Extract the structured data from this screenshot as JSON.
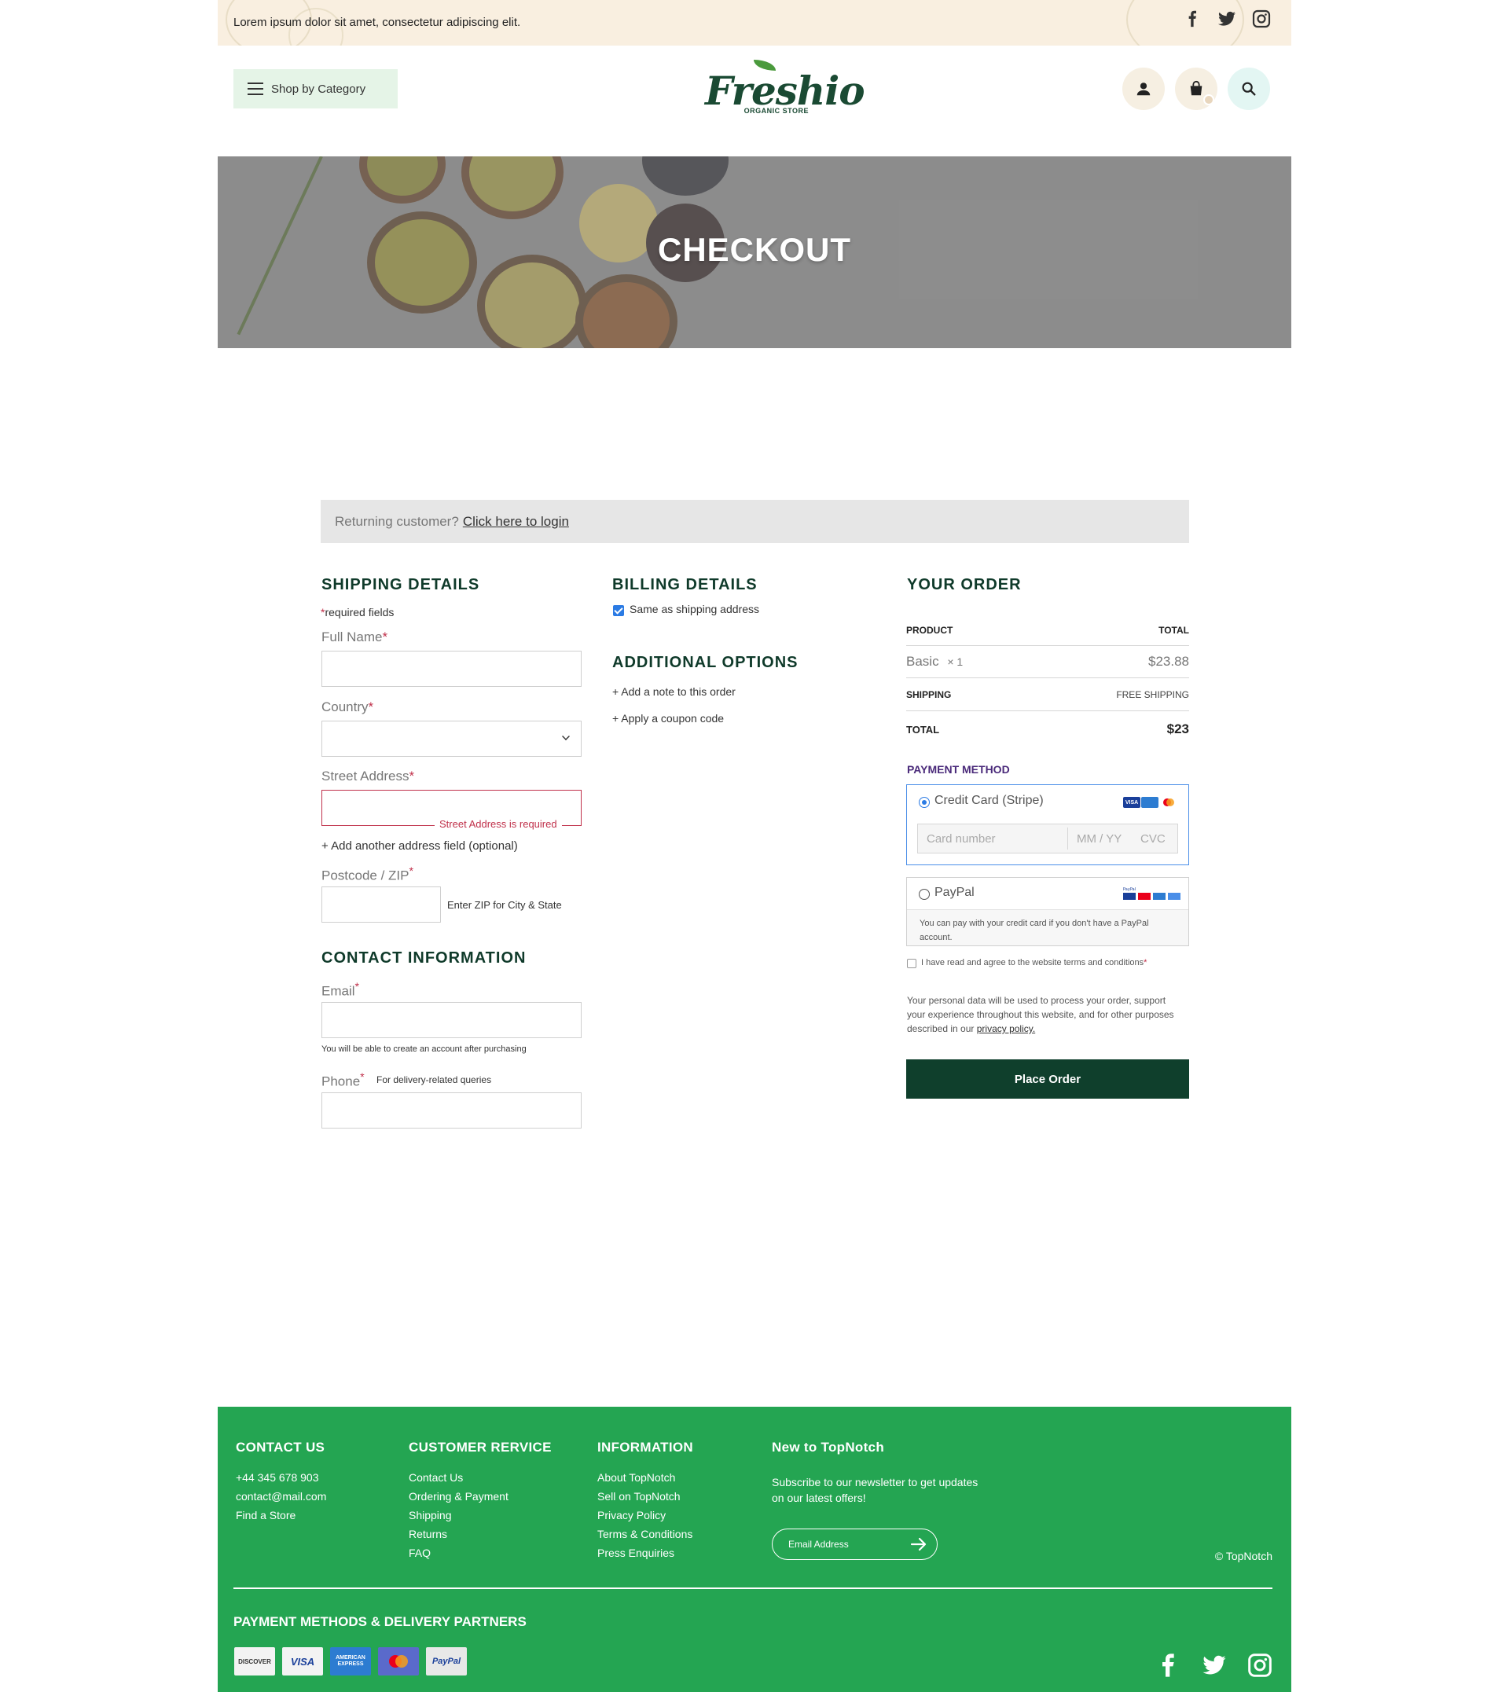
{
  "topbar": {
    "message": "Lorem ipsum dolor sit amet, consectetur adipiscing elit.",
    "social_icons": [
      "facebook-icon",
      "twitter-icon",
      "instagram-icon"
    ]
  },
  "header": {
    "category_button": "Shop by Category",
    "logo_word": "Freshio",
    "logo_sub": "ORGANIC STORE",
    "icons": [
      "user-icon",
      "bag-icon",
      "search-icon"
    ]
  },
  "hero": {
    "title": "CHECKOUT"
  },
  "login": {
    "prompt": "Returning customer?",
    "link": "Click here to login"
  },
  "shipping": {
    "title": "SHIPPING DETAILS",
    "required_note": "required fields",
    "full_name_label": "Full Name",
    "country_label": "Country",
    "street_label": "Street Address",
    "street_error": "Street Address is required",
    "add_address": "+ Add another address field (optional)",
    "postcode_label": "Postcode / ZIP",
    "postcode_hint": "Enter ZIP for City & State"
  },
  "contact": {
    "title": "CONTACT INFORMATION",
    "email_label": "Email",
    "email_hint": "You will be able to create an account after purchasing",
    "phone_label": "Phone",
    "phone_hint": "For delivery-related queries"
  },
  "billing": {
    "title": "BILLING DETAILS",
    "same_as_shipping": "Same as shipping address"
  },
  "additional": {
    "title": "ADDITIONAL OPTIONS",
    "add_note": "+ Add a note to this order",
    "apply_coupon": "+ Apply a coupon code"
  },
  "order": {
    "title": "YOUR ORDER",
    "col_product": "PRODUCT",
    "col_total": "TOTAL",
    "item_name": "Basic",
    "item_qty": "× 1",
    "item_price": "$23.88",
    "shipping_label": "SHIPPING",
    "shipping_value": "FREE SHIPPING",
    "total_label": "TOTAL",
    "total_value": "$23",
    "payment_title": "PAYMENT METHOD",
    "card_option": "Credit Card (Stripe)",
    "card_number_placeholder": "Card number",
    "card_expiry_placeholder": "MM / YY",
    "card_cvc_placeholder": "CVC",
    "paypal_option": "PayPal",
    "paypal_note": "You can pay with your credit card if you don't have a PayPal account.",
    "terms": "I have read and agree to the website terms and conditions",
    "privacy_text": "Your personal data will be used to process your order, support your experience throughout this website, and for other purposes described in our",
    "privacy_link": "privacy policy.",
    "place_order": "Place Order"
  },
  "footer": {
    "contact_title": "CONTACT US",
    "contact_items": [
      "+44 345 678 903",
      "contact@mail.com",
      "Find a Store"
    ],
    "service_title": "CUSTOMER RERVICE",
    "service_items": [
      "Contact Us",
      "Ordering & Payment",
      "Shipping",
      "Returns",
      "FAQ"
    ],
    "info_title": "INFORMATION",
    "info_items": [
      "About TopNotch",
      "Sell on TopNotch",
      "Privacy Policy",
      "Terms & Conditions",
      "Press Enquiries"
    ],
    "newsletter_title": "New to TopNotch",
    "newsletter_text": "Subscribe to our newsletter to get updates on our latest offers!",
    "newsletter_placeholder": "Email Address",
    "copyright": "© TopNotch",
    "payments_title": "PAYMENT METHODS & DELIVERY PARTNERS",
    "payment_logos": [
      "DISCOVER",
      "VISA",
      "AMERICAN EXPRESS",
      "",
      "PayPal"
    ]
  },
  "colors": {
    "brand_dark": "#0f3f2c",
    "footer_green": "#24a552",
    "error": "#c0304a",
    "accent_blue": "#2b7be4"
  }
}
